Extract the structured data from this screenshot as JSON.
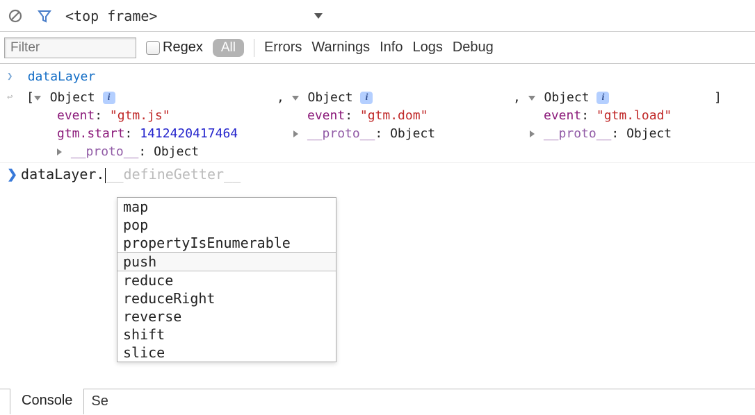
{
  "toolbar": {
    "frame_label": "<top frame>"
  },
  "filterbar": {
    "filter_placeholder": "Filter",
    "regex_label": "Regex",
    "tabs": {
      "all": "All",
      "errors": "Errors",
      "warnings": "Warnings",
      "info": "Info",
      "logs": "Logs",
      "debug": "Debug"
    }
  },
  "console": {
    "entry_label": "dataLayer",
    "object_label": "Object",
    "proto_label": "__proto__",
    "objects": [
      {
        "event_key": "event",
        "event_val": "\"gtm.js\"",
        "extra_key": "gtm.start",
        "extra_val": "1412420417464"
      },
      {
        "event_key": "event",
        "event_val": "\"gtm.dom\""
      },
      {
        "event_key": "event",
        "event_val": "\"gtm.load\""
      }
    ],
    "open_bracket": "[",
    "close_bracket": "]",
    "comma": ","
  },
  "prompt": {
    "typed": "dataLayer.",
    "suggestion_inline": "__defineGetter__"
  },
  "autocomplete": {
    "items": [
      "map",
      "pop",
      "propertyIsEnumerable",
      "push",
      "reduce",
      "reduceRight",
      "reverse",
      "shift",
      "slice"
    ],
    "selected_index": 3
  },
  "footer": {
    "tab1": "Console",
    "tab2_partial": "Se"
  }
}
